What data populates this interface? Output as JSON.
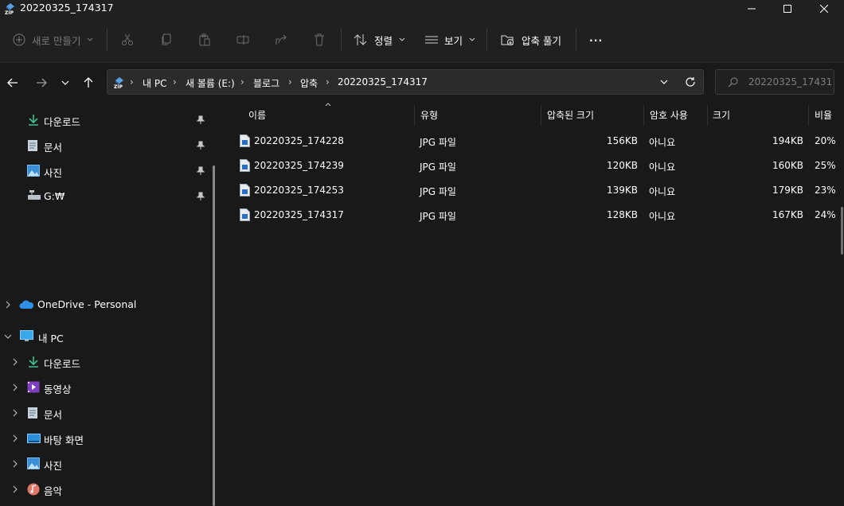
{
  "window": {
    "title": "20220325_174317",
    "app_icon": "zip-folder-icon"
  },
  "toolbar": {
    "new_label": "새로 만들기",
    "sort_label": "정렬",
    "view_label": "보기",
    "extract_label": "압축 풀기",
    "more_label": "···"
  },
  "address": {
    "crumbs": [
      "내 PC",
      "새 볼륨 (E:)",
      "블로그",
      "압축",
      "20220325_174317"
    ]
  },
  "search": {
    "placeholder": "20220325_17431..."
  },
  "nav": {
    "quick": [
      {
        "label": "다운로드",
        "icon": "download-icon"
      },
      {
        "label": "문서",
        "icon": "document-icon"
      },
      {
        "label": "사진",
        "icon": "pictures-icon"
      },
      {
        "label": "G:₩",
        "icon": "network-drive-icon"
      }
    ],
    "onedrive": "OneDrive - Personal",
    "pc": "내 PC",
    "pc_items": [
      {
        "label": "다운로드",
        "icon": "download-icon"
      },
      {
        "label": "동영상",
        "icon": "videos-icon"
      },
      {
        "label": "문서",
        "icon": "document-icon"
      },
      {
        "label": "바탕 화면",
        "icon": "desktop-icon"
      },
      {
        "label": "사진",
        "icon": "pictures-icon"
      },
      {
        "label": "음악",
        "icon": "music-icon"
      }
    ]
  },
  "columns": {
    "name": "이름",
    "type": "유형",
    "packed": "압축된 크기",
    "password": "암호 사용",
    "size": "크기",
    "ratio": "비율"
  },
  "files": [
    {
      "name": "20220325_174228",
      "type": "JPG 파일",
      "packed": "156KB",
      "password": "아니요",
      "size": "194KB",
      "ratio": "20%"
    },
    {
      "name": "20220325_174239",
      "type": "JPG 파일",
      "packed": "120KB",
      "password": "아니요",
      "size": "160KB",
      "ratio": "25%"
    },
    {
      "name": "20220325_174253",
      "type": "JPG 파일",
      "packed": "139KB",
      "password": "아니요",
      "size": "179KB",
      "ratio": "23%"
    },
    {
      "name": "20220325_174317",
      "type": "JPG 파일",
      "packed": "128KB",
      "password": "아니요",
      "size": "167KB",
      "ratio": "24%"
    }
  ]
}
